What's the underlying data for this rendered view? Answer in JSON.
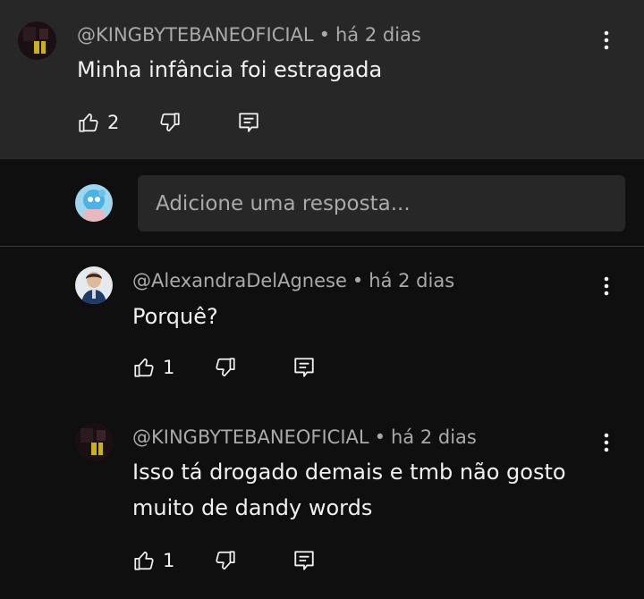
{
  "parent_comment": {
    "author": "@KINGBYTEBANEOFICIAL",
    "time": "há 2 dias",
    "separator": "•",
    "text": "Minha infância foi estragada",
    "likes": "2",
    "avatar_icon": "dark-avatar-icon"
  },
  "reply_box": {
    "placeholder": "Adicione uma resposta..."
  },
  "replies": [
    {
      "author": "@AlexandraDelAgnese",
      "time": "há 2 dias",
      "separator": "•",
      "text": "Porquê?",
      "likes": "1"
    },
    {
      "author": "@KINGBYTEBANEOFICIAL",
      "time": "há 2 dias",
      "separator": "•",
      "text_line1": "Isso tá drogado demais e tmb não gosto",
      "text_line2": "muito de dandy words",
      "likes": "1"
    }
  ],
  "colors": {
    "background": "#0f0f0f",
    "card": "#272727",
    "text": "#f1f1f1",
    "meta": "#aaaaaa"
  }
}
